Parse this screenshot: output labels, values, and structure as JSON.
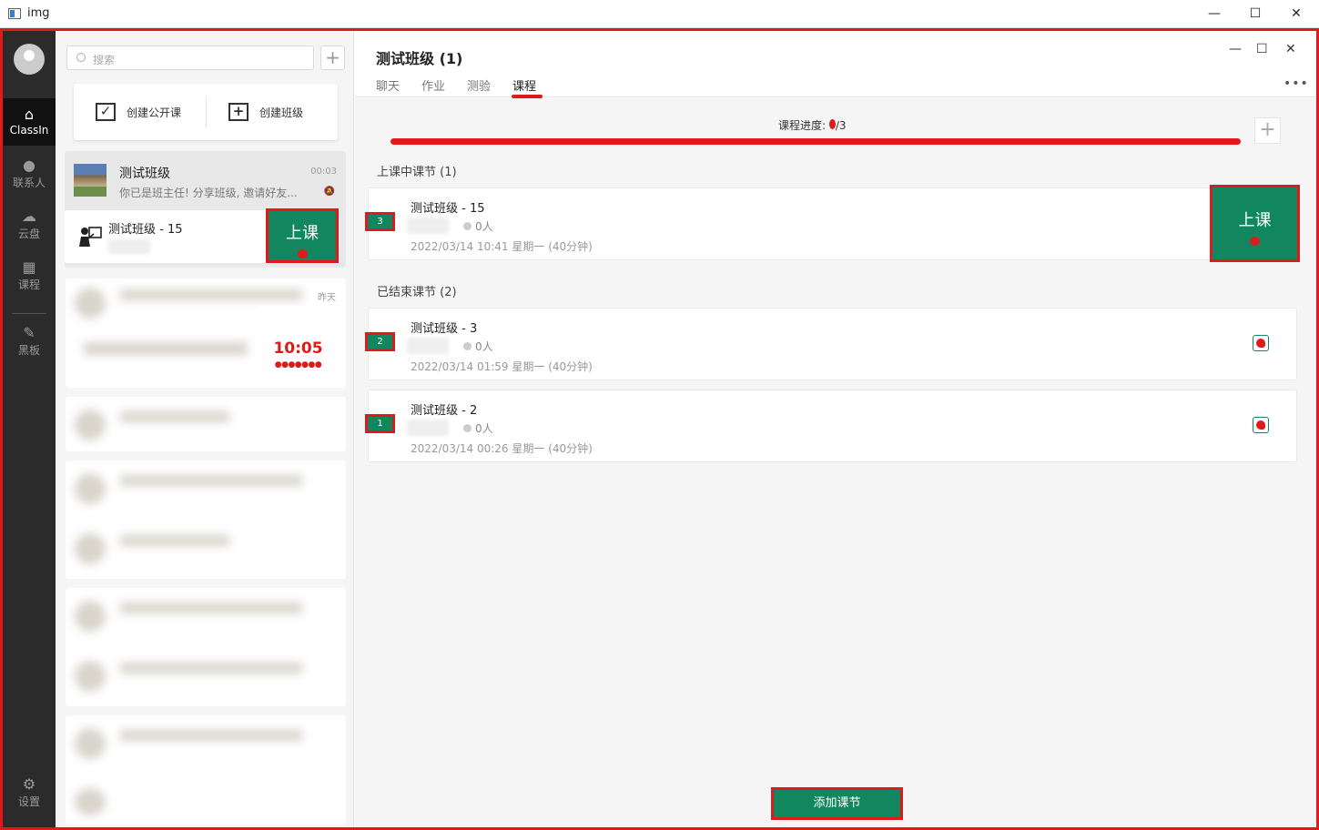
{
  "window": {
    "title": "img",
    "min_icon": "minimize-icon",
    "max_icon": "maximize-icon",
    "close_icon": "close-icon"
  },
  "rail": {
    "items": [
      {
        "label": "ClassIn",
        "icon": "home-icon"
      },
      {
        "label": "联系人",
        "icon": "contacts-icon"
      },
      {
        "label": "云盘",
        "icon": "cloud-icon"
      },
      {
        "label": "课程",
        "icon": "calendar-icon"
      },
      {
        "label": "黑板",
        "icon": "blackboard-icon"
      },
      {
        "label": "设置",
        "icon": "settings-icon"
      }
    ]
  },
  "left": {
    "search_placeholder": "搜索",
    "create_open_course": "创建公开课",
    "create_class": "创建班级",
    "conversation": {
      "name": "测试班级",
      "time": "00:03",
      "snippet": "你已是班主任! 分享班级, 邀请好友..."
    },
    "sub_lesson": {
      "name": "测试班级 - 15"
    },
    "start_button": "上课",
    "yesterday": "昨天",
    "notif_time": "10:05"
  },
  "main": {
    "title": "测试班级 (1)",
    "tabs": [
      "聊天",
      "作业",
      "测验",
      "课程"
    ],
    "active_tab": "课程",
    "progress_label": "课程进度: ",
    "progress_value": "/3",
    "progress_fraction": 0.33,
    "in_progress_header": "上课中课节 (1)",
    "ended_header": "已结束课节 (2)",
    "lessons": [
      {
        "badge": "3",
        "name": "测试班级 - 15",
        "people": "0人",
        "datetime": "2022/03/14 10:41 星期一 (40分钟)"
      },
      {
        "badge": "2",
        "name": "测试班级 - 3",
        "people": "0人",
        "datetime": "2022/03/14 01:59 星期一 (40分钟)"
      },
      {
        "badge": "1",
        "name": "测试班级 - 2",
        "people": "0人",
        "datetime": "2022/03/14 00:26 星期一 (40分钟)"
      }
    ],
    "start_button": "上课",
    "add_lesson_button": "添加课节"
  },
  "colors": {
    "accent": "#12875f",
    "annotation": "#e01a1a",
    "rail": "#2b2b2b"
  }
}
